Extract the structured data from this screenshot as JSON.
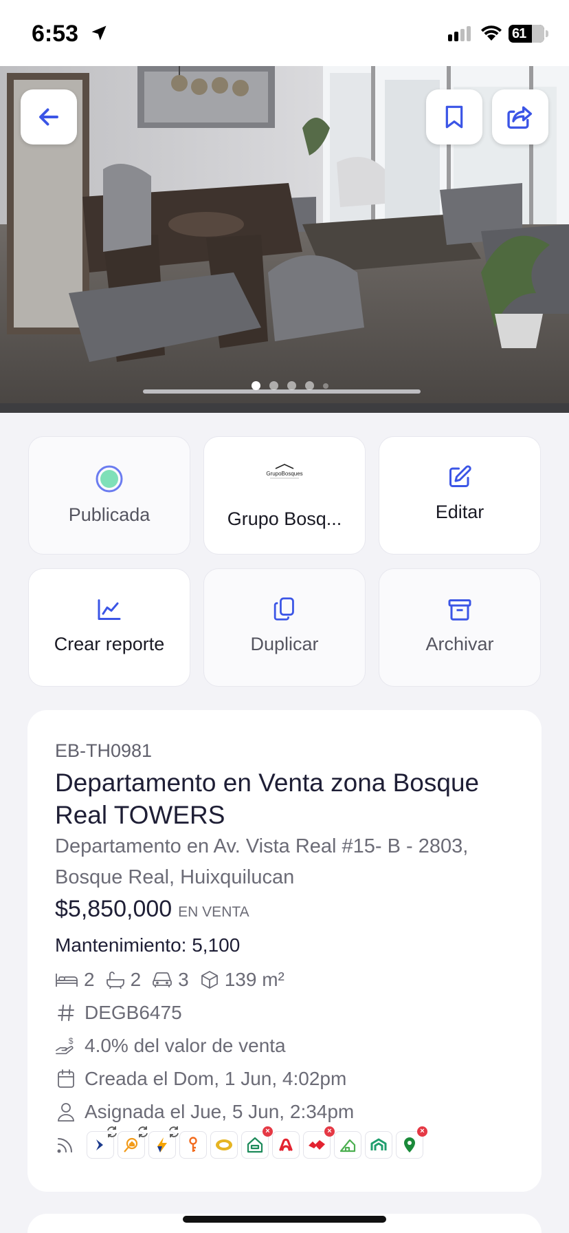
{
  "status_bar": {
    "time": "6:53",
    "battery": "61"
  },
  "hero": {
    "image": "living-room-photo",
    "dots_active": 1,
    "dots_total": 5
  },
  "tiles": [
    {
      "label": "Publicada",
      "icon": "status-dot-icon",
      "color": "#7fe0b8"
    },
    {
      "label": "Grupo Bosq...",
      "icon": "agency-logo",
      "logo_text": "GrupoBosques"
    },
    {
      "label": "Editar",
      "icon": "edit-icon"
    },
    {
      "label": "Crear reporte",
      "icon": "chart-icon"
    },
    {
      "label": "Duplicar",
      "icon": "copy-icon"
    },
    {
      "label": "Archivar",
      "icon": "archive-icon"
    }
  ],
  "listing": {
    "code": "EB-TH0981",
    "title": "Departamento en Venta zona Bosque Real TOWERS",
    "address": "Departamento en Av. Vista Real #15- B - 2803, Bosque Real, Huixquilucan",
    "price": "$5,850,000",
    "operation": "EN VENTA",
    "maintenance": "Mantenimiento: 5,100",
    "features": {
      "bedrooms": "2",
      "bathrooms": "2",
      "parking": "3",
      "area": "139 m²"
    },
    "internal_id": "DEGB6475",
    "commission": "4.0% del valor de venta",
    "created": "Creada el Dom, 1 Jun, 4:02pm",
    "assigned": "Asignada el Jue, 5 Jun, 2:34pm"
  },
  "portals": [
    {
      "name": "portal-1",
      "color": "#1b3a8c",
      "status": "sync"
    },
    {
      "name": "portal-2",
      "color": "#f29b1a",
      "status": "sync"
    },
    {
      "name": "portal-3",
      "color": "#f5a300",
      "status": "sync"
    },
    {
      "name": "portal-4",
      "color": "#f26b1d",
      "status": "ok"
    },
    {
      "name": "portal-5",
      "color": "#e6b422",
      "status": "ok"
    },
    {
      "name": "portal-6",
      "color": "#1d8a5a",
      "status": "error"
    },
    {
      "name": "portal-7",
      "color": "#e32330",
      "status": "ok"
    },
    {
      "name": "portal-8",
      "color": "#e32330",
      "status": "error"
    },
    {
      "name": "portal-9",
      "color": "#4caf50",
      "status": "ok"
    },
    {
      "name": "portal-10",
      "color": "#1f9e6e",
      "status": "ok"
    },
    {
      "name": "portal-11",
      "color": "#1b8a3a",
      "status": "error"
    }
  ],
  "colors": {
    "accent": "#3b55e6",
    "success": "#7fe0b8",
    "error": "#e53945"
  }
}
